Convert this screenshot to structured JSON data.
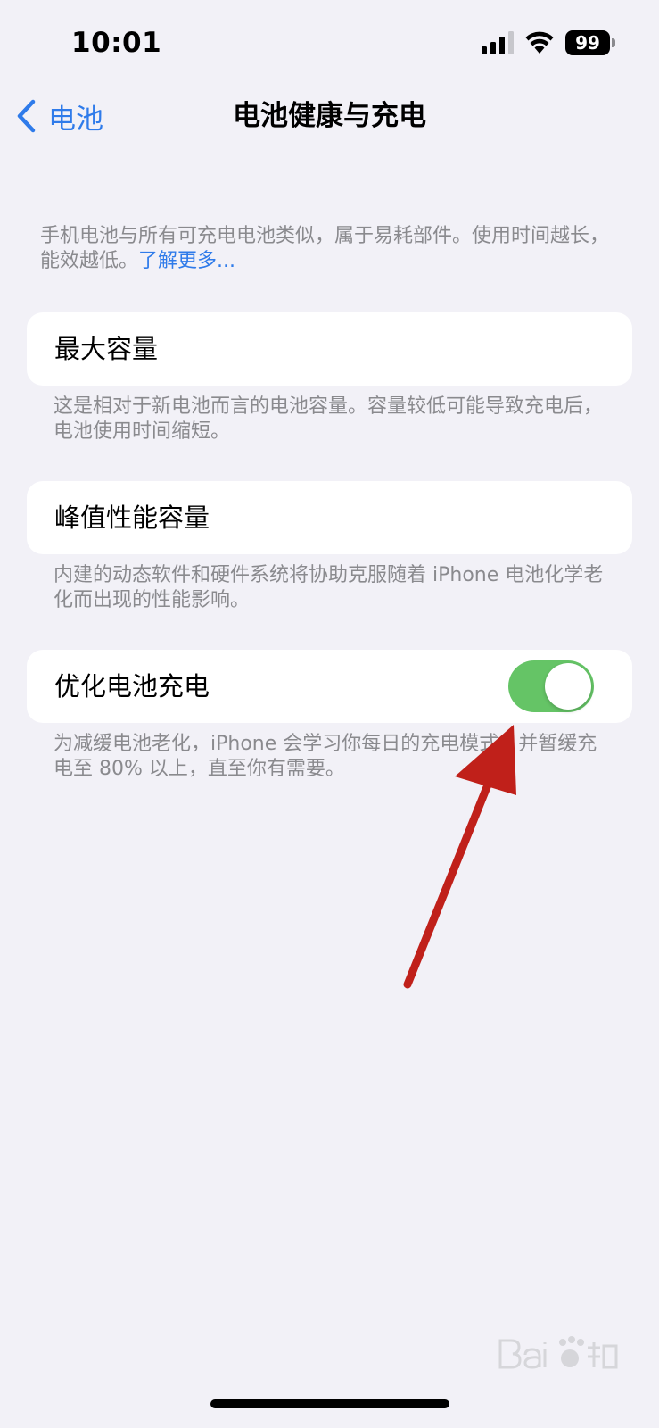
{
  "status_bar": {
    "time": "10:01",
    "battery_level": "99",
    "icons": [
      "signal-icon",
      "wifi-icon",
      "battery-icon"
    ]
  },
  "nav": {
    "back_label": "电池",
    "title": "电池健康与充电"
  },
  "intro": {
    "text": "手机电池与所有可充电电池类似，属于易耗部件。使用时间越长，能效越低。",
    "link": "了解更多..."
  },
  "sections": {
    "max_capacity": {
      "label": "最大容量",
      "footnote": "这是相对于新电池而言的电池容量。容量较低可能导致充电后，电池使用时间缩短。"
    },
    "peak_performance": {
      "label": "峰值性能容量",
      "footnote": "内建的动态软件和硬件系统将协助克服随着 iPhone 电池化学老化而出现的性能影响。"
    },
    "optimized_charging": {
      "label": "优化电池充电",
      "enabled": true,
      "footnote": "为减缓电池老化，iPhone 会学习你每日的充电模式，并暂缓充电至 80% 以上，直至你有需要。"
    }
  },
  "colors": {
    "background": "#F2F1F7",
    "accent": "#2F7BEA",
    "toggle_on": "#65C466",
    "annotation_arrow": "#C0201A"
  }
}
